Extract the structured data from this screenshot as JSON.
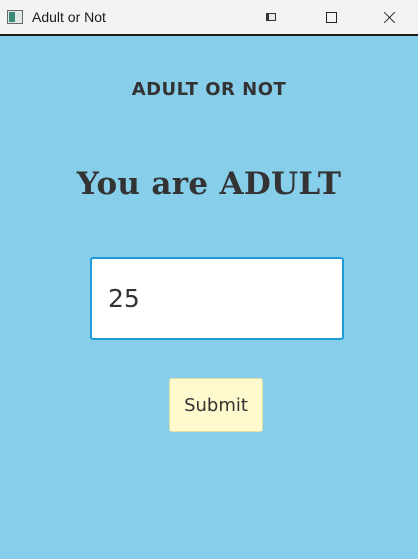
{
  "window": {
    "title": "Adult or Not",
    "icon": "app-window-icon",
    "controls": {
      "minimize_icon": "minimize-icon",
      "maximize_icon": "maximize-icon",
      "close_icon": "close-icon"
    }
  },
  "main": {
    "heading": "ADULT OR NOT",
    "result": "You are ADULT",
    "age_input": {
      "value": "25",
      "placeholder": ""
    },
    "submit_label": "Submit"
  },
  "colors": {
    "background": "#87ceeb",
    "text": "#333333",
    "input_border": "#1e9ad6",
    "button_background": "#fffacd"
  }
}
